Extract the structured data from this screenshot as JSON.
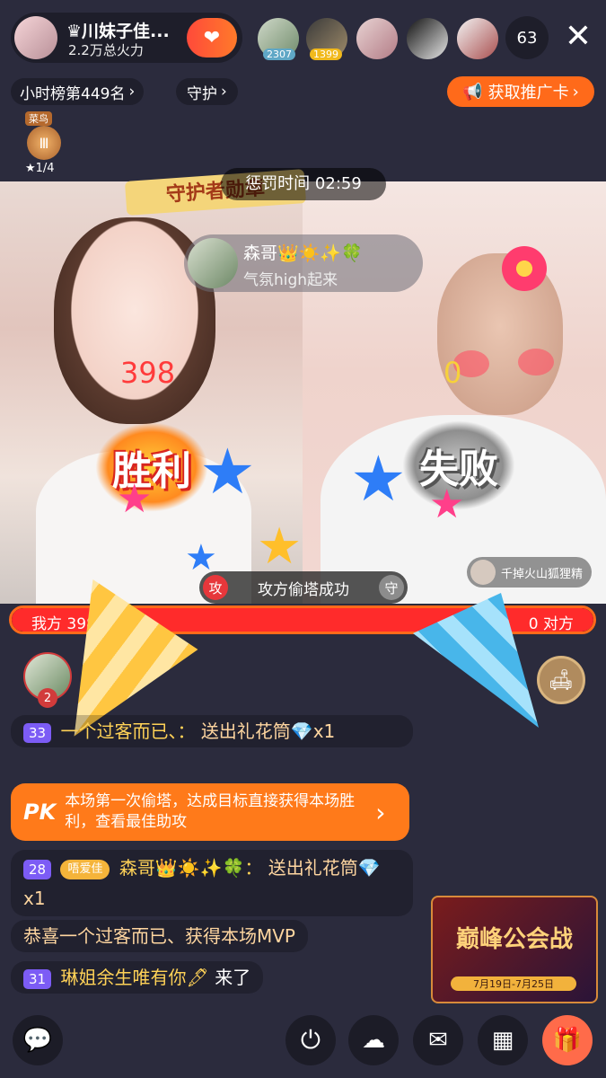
{
  "host": {
    "name": "♛川妹子佳...",
    "heat": "2.2万总火力",
    "viewer_count": "63",
    "viewers": [
      {
        "badge": "2307"
      },
      {
        "badge": "1399"
      },
      {
        "badge": ""
      },
      {
        "badge": ""
      },
      {
        "badge": ""
      }
    ]
  },
  "nav": {
    "rank": "小时榜第449名",
    "guard": "守护",
    "promo": "获取推广卡"
  },
  "level_badge": {
    "title": "菜鸟",
    "progress": "★1/4"
  },
  "pk": {
    "guardian_banner": "守护者勋章",
    "timer": "惩罚时间 02:59",
    "left_score": "398",
    "right_score": "0",
    "left_result": "胜利",
    "right_result": "失败",
    "event_attack": "攻",
    "event_text": "攻方偷塔成功",
    "event_guard": "守",
    "bar_left": "我方 398",
    "bar_right": "0 对方",
    "bar_fill_fraction": 1.0,
    "right_anchor": "千掉火山狐狸精"
  },
  "comment_bubble": {
    "name": "森哥👑☀️✨🍀",
    "text": "气氛high起来"
  },
  "chat": {
    "mvp_rank": "2",
    "messages": [
      {
        "level": "33",
        "name": "一个过客而已、：",
        "text": "送出礼花筒💎x1"
      },
      {
        "pk_tag": "PK",
        "text": "本场第一次偷塔，达成目标直接获得本场胜利，查看最佳助攻"
      },
      {
        "level": "28",
        "fan_badge": "唔爱佳",
        "name": "森哥👑☀️✨🍀：",
        "text": "送出礼花筒💎 x1"
      },
      {
        "text": "恭喜一个过客而已、获得本场MVP"
      },
      {
        "level": "31",
        "name": "琳姐余生唯有你🖋",
        "text": "来了"
      }
    ]
  },
  "event_banner": {
    "title": "巅峰公会战",
    "dates": "7月19日-7月25日"
  },
  "toolbar": {
    "icons": [
      "chat-icon",
      "power-icon",
      "link-mic-icon",
      "message-icon",
      "more-icon",
      "gift-icon"
    ]
  },
  "colors": {
    "accent": "#ff6a1a",
    "pk_bar": "#ff2b2b",
    "level": "#7c5cf5"
  }
}
